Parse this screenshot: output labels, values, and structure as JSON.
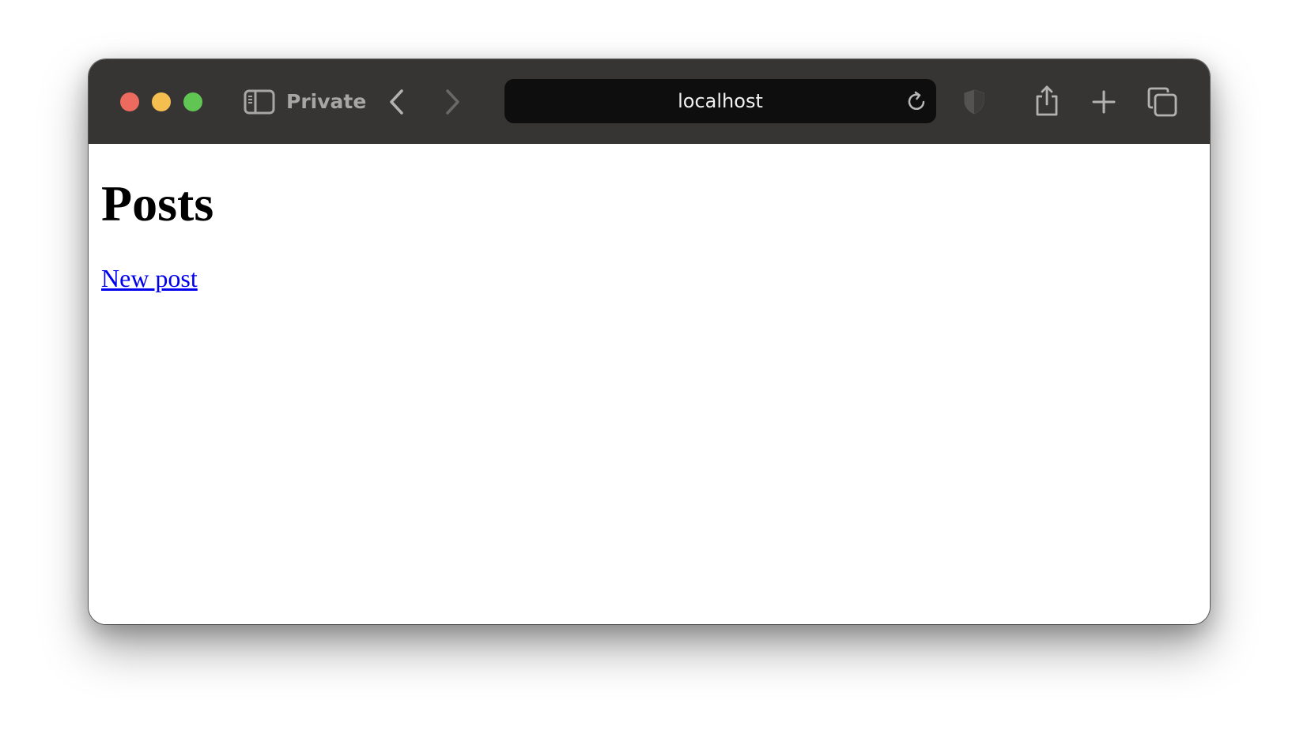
{
  "browser": {
    "window_label": "Private",
    "address": "localhost",
    "colors": {
      "toolbar": "#373534",
      "address_bar": "#0e0e0e",
      "close": "#ed6a5e",
      "minimize": "#f5bf4f",
      "zoom": "#61c554"
    },
    "icons": [
      "sidebar-icon",
      "back-chevron-icon",
      "forward-chevron-icon",
      "reload-icon",
      "shield-icon",
      "share-icon",
      "plus-icon",
      "tabs-overview-icon"
    ]
  },
  "page": {
    "title": "Posts",
    "new_post_link": "New post",
    "link_color": "#0000ee"
  }
}
